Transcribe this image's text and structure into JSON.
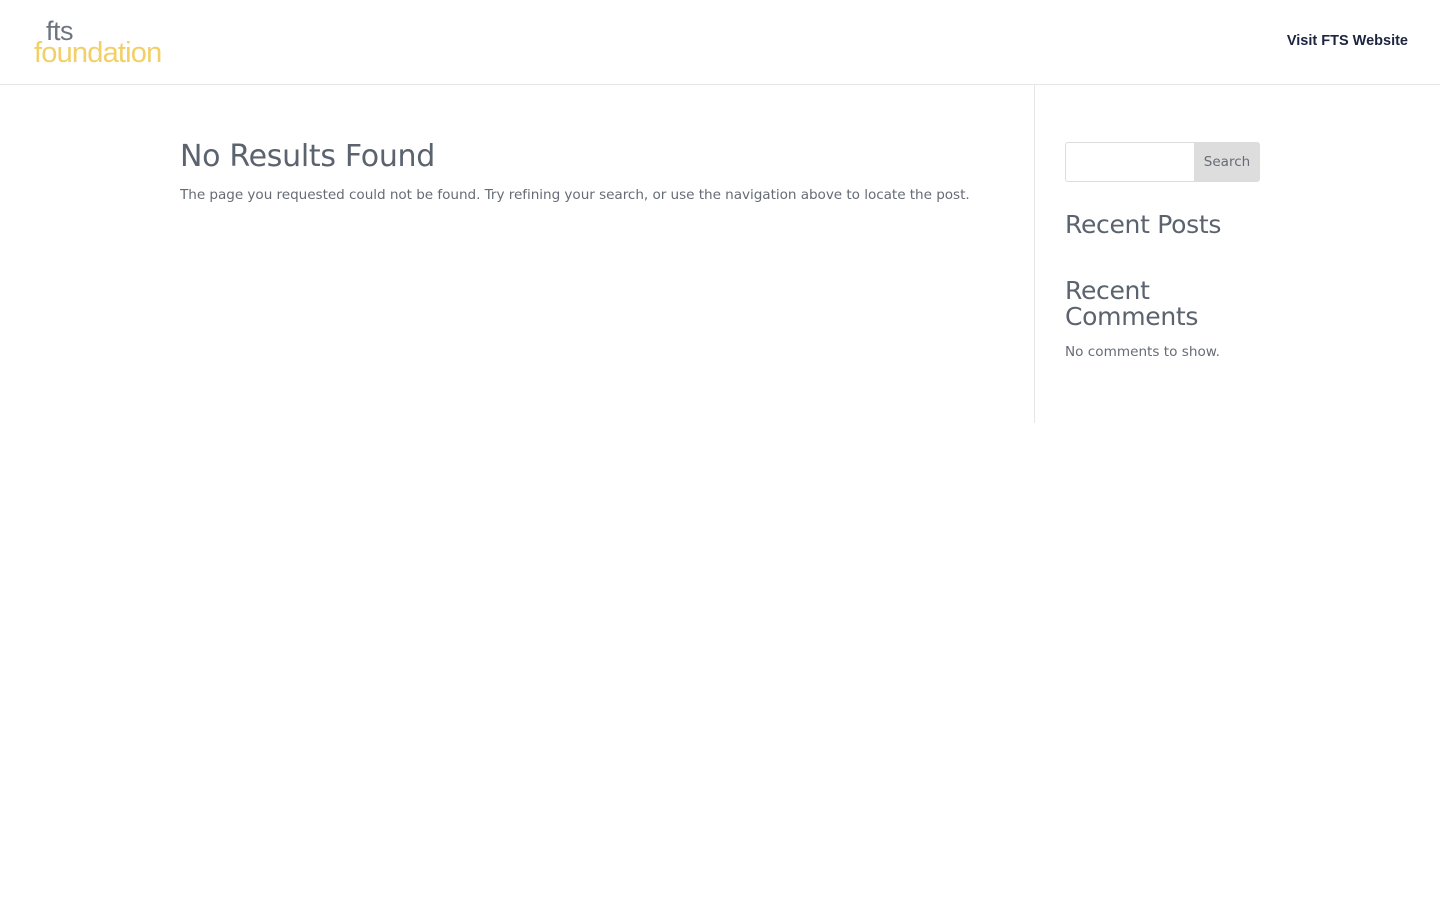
{
  "header": {
    "logo": {
      "line1": "fts",
      "line2": "foundation",
      "color_top": "#6d7480",
      "color_bottom": "#f2cf67"
    },
    "nav_link": "Visit FTS Website"
  },
  "main": {
    "title": "No Results Found",
    "message": "The page you requested could not be found. Try refining your search, or use the navigation above to locate the post."
  },
  "sidebar": {
    "search": {
      "value": "",
      "placeholder": "",
      "button_label": "Search"
    },
    "recent_posts": {
      "title": "Recent Posts"
    },
    "recent_comments": {
      "title": "Recent Comments",
      "empty_text": "No comments to show."
    }
  }
}
